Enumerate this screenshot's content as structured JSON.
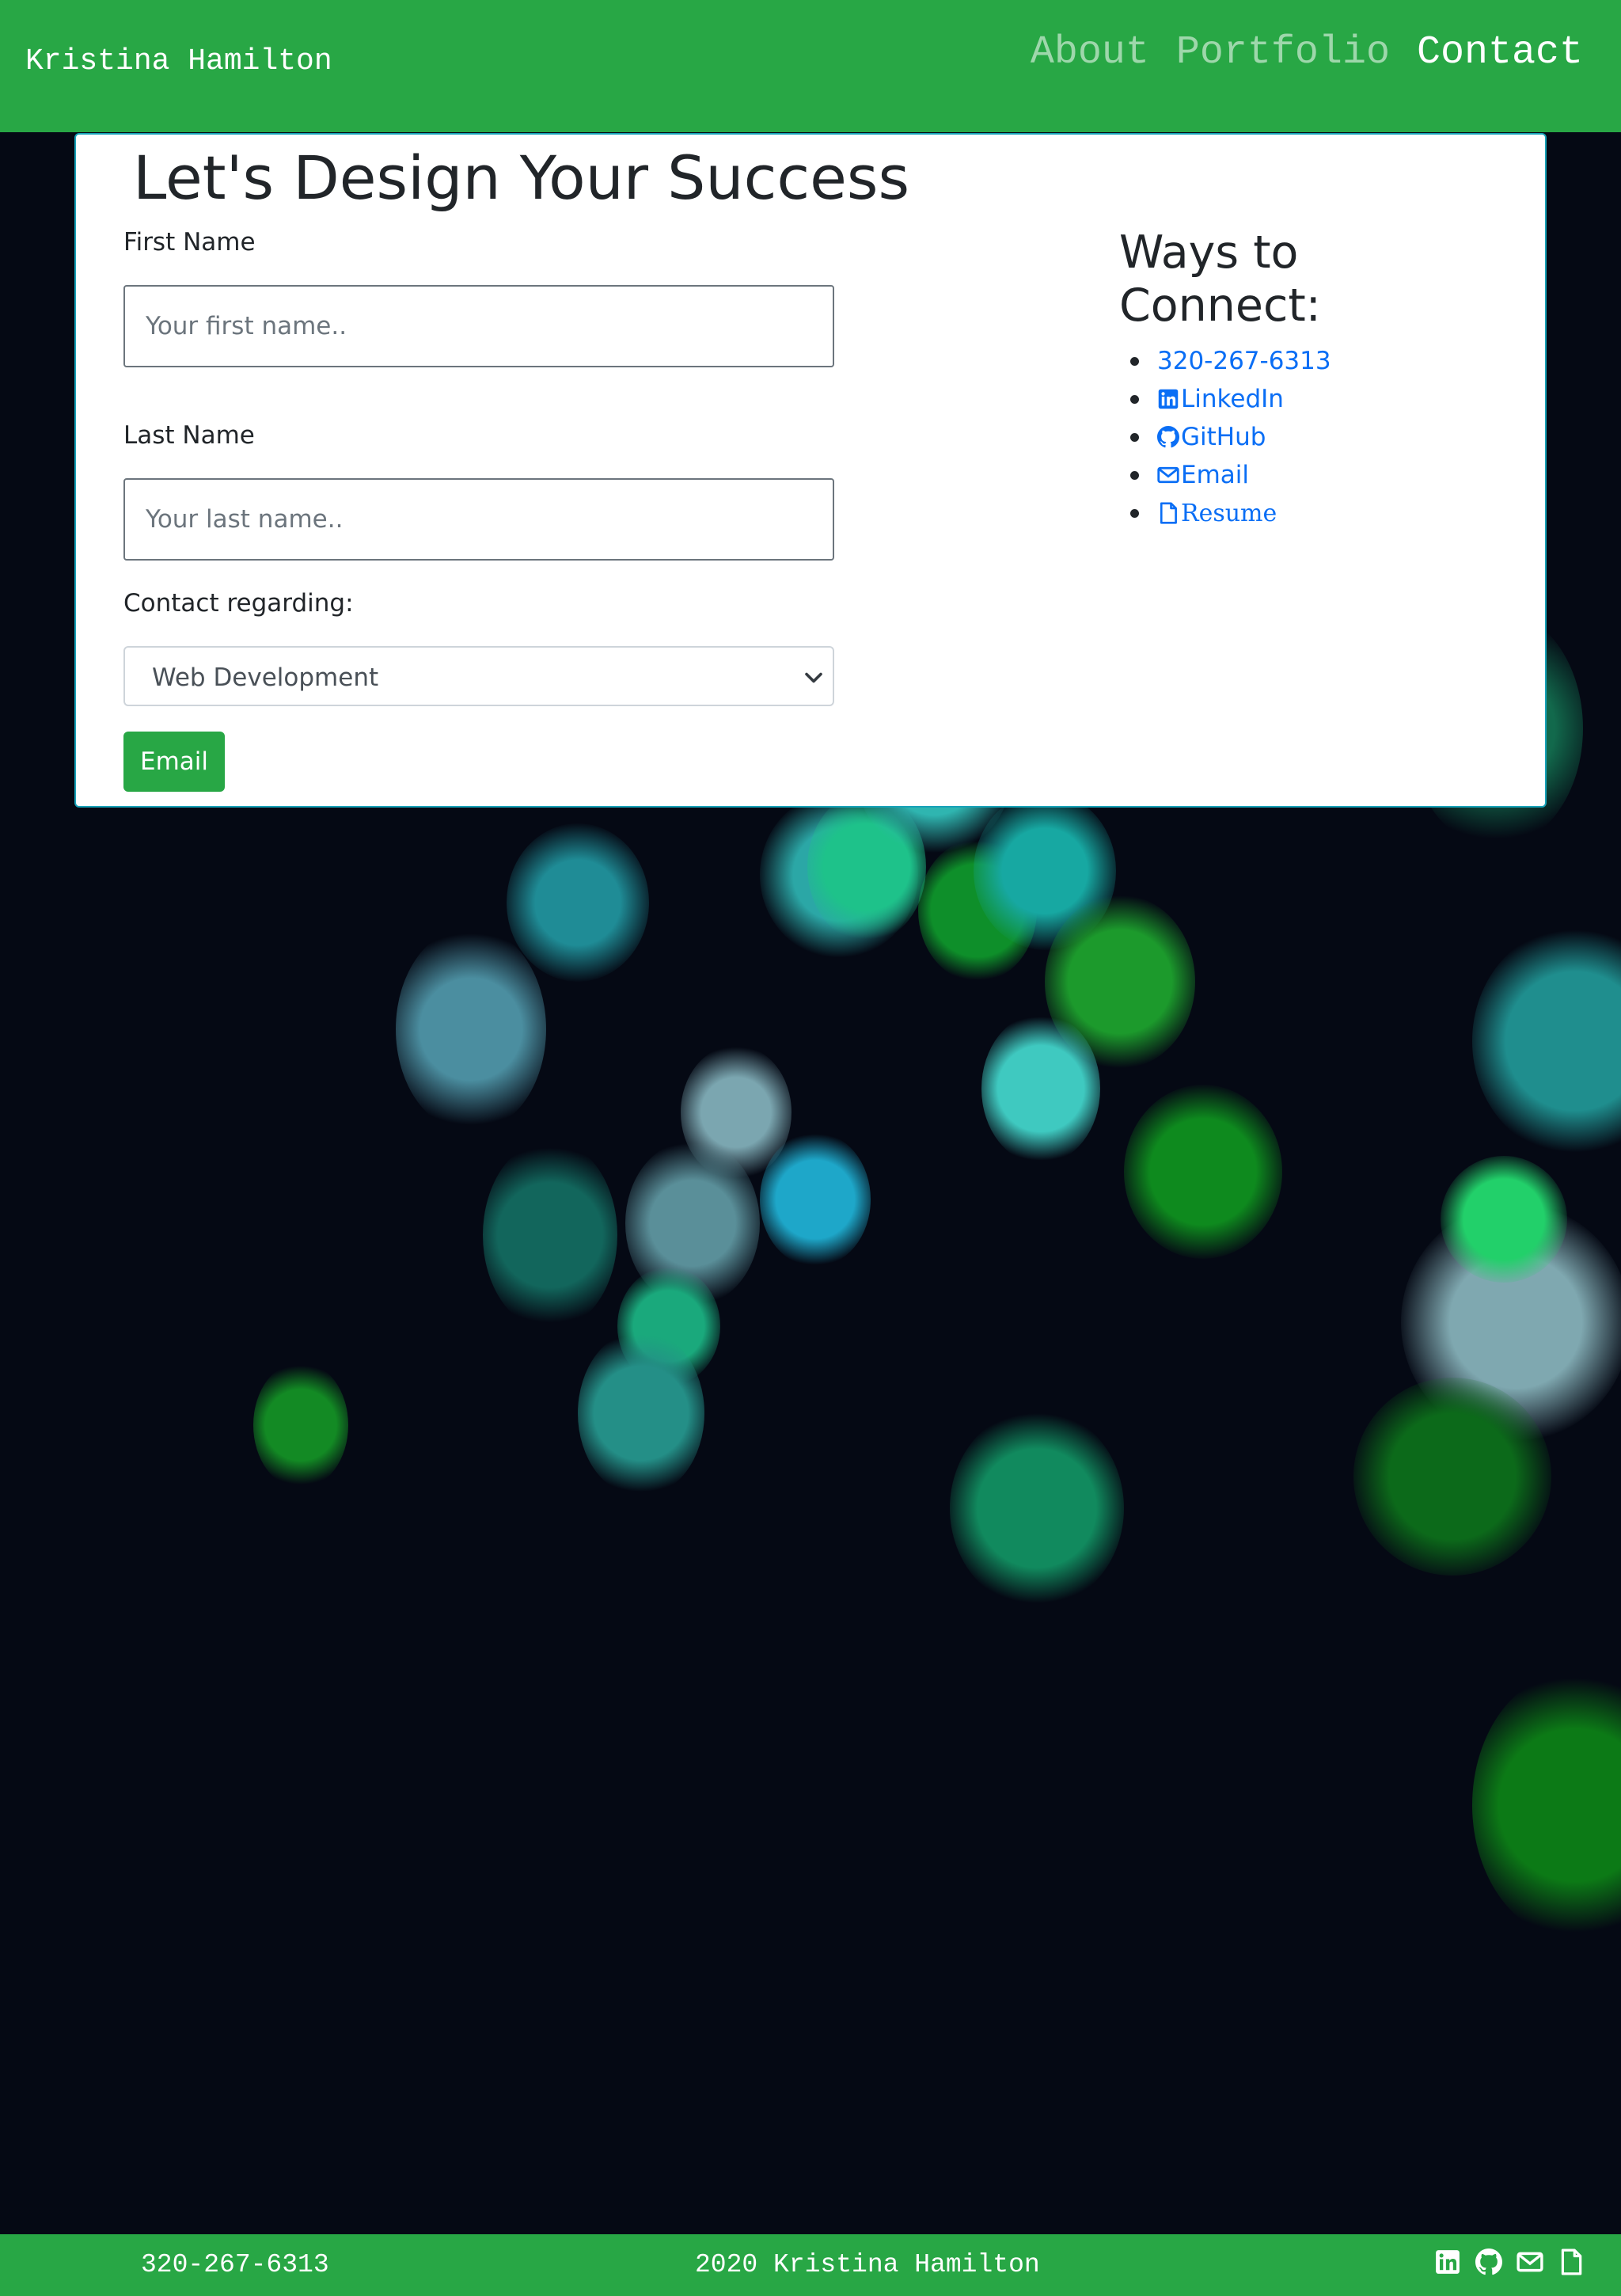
{
  "header": {
    "brand": "Kristina Hamilton",
    "nav": [
      {
        "label": "About"
      },
      {
        "label": "Portfolio"
      },
      {
        "label": "Contact"
      }
    ]
  },
  "contact_form": {
    "title": "Let's Design Your Success",
    "first_name": {
      "label": "First Name",
      "placeholder": "Your first name..",
      "value": ""
    },
    "last_name": {
      "label": "Last Name",
      "placeholder": "Your last name..",
      "value": ""
    },
    "regarding": {
      "label": "Contact regarding:",
      "selected": "Web Development"
    },
    "submit_label": "Email"
  },
  "connect": {
    "title": "Ways to Connect:",
    "items": [
      {
        "label": "320-267-6313",
        "icon": "none"
      },
      {
        "label": "LinkedIn",
        "icon": "linkedin-icon"
      },
      {
        "label": "GitHub",
        "icon": "github-icon"
      },
      {
        "label": "Email",
        "icon": "envelope-icon"
      },
      {
        "label": "Resume",
        "icon": "file-icon"
      }
    ]
  },
  "footer": {
    "phone": "320-267-6313",
    "copyright": "2020 Kristina Hamilton",
    "icons": [
      "linkedin-icon",
      "github-icon",
      "envelope-icon",
      "file-icon"
    ]
  },
  "colors": {
    "brand_green": "#28a745",
    "link_blue": "#0a6ef5",
    "card_border": "#17a2b8",
    "page_background": "#050914"
  }
}
